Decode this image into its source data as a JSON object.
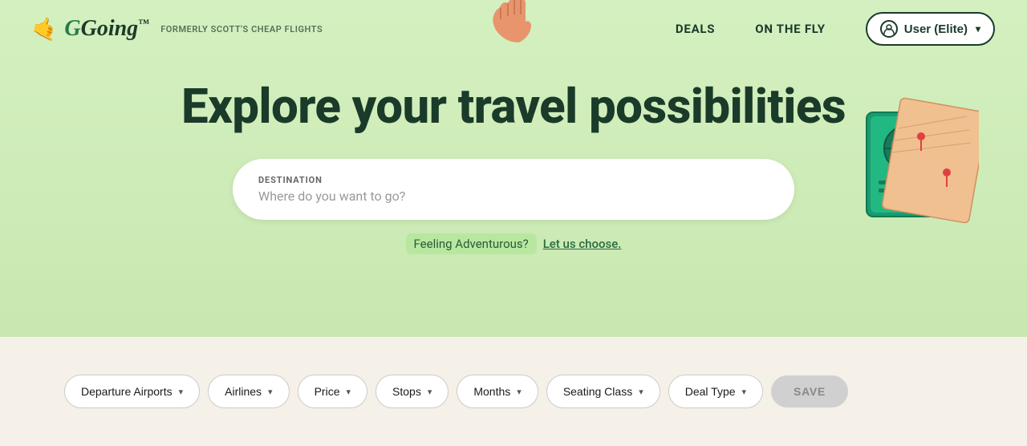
{
  "header": {
    "logo_text": "Going",
    "logo_tm": "™",
    "formerly_text": "FORMERLY SCOTT'S CHEAP FLIGHTS",
    "nav": {
      "deals_label": "DEALS",
      "on_the_fly_label": "ON THE FLY"
    },
    "user_button_label": "User (Elite)",
    "user_chevron": "▾"
  },
  "hero": {
    "title": "Explore your travel possibilities",
    "search": {
      "label": "DESTINATION",
      "placeholder": "Where do you want to go?"
    },
    "adventure_static": "Feeling Adventurous?",
    "adventure_link": "Let us choose."
  },
  "filters": {
    "items": [
      {
        "label": "Departure Airports",
        "id": "departure-airports"
      },
      {
        "label": "Airlines",
        "id": "airlines"
      },
      {
        "label": "Price",
        "id": "price"
      },
      {
        "label": "Stops",
        "id": "stops"
      },
      {
        "label": "Months",
        "id": "months"
      },
      {
        "label": "Seating Class",
        "id": "seating-class"
      },
      {
        "label": "Deal Type",
        "id": "deal-type"
      }
    ],
    "save_label": "SAVE"
  },
  "colors": {
    "hero_bg": "#d4f0c0",
    "bottom_bg": "#f5f0e8",
    "dark_text": "#1a3a2a",
    "save_bg": "#d0d0d0"
  }
}
